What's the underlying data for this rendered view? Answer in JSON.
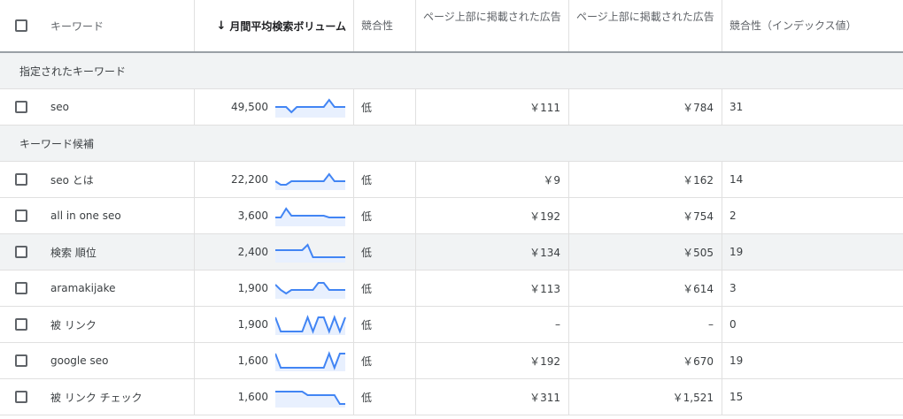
{
  "header": {
    "keyword": "キーワード",
    "volume": "月間平均検索ボリューム",
    "competition": "競合性",
    "bid_low": "ページ上部に掲載された広告",
    "bid_high": "ページ上部に掲載された広告",
    "comp_index": "競合性（インデックス値）",
    "sort_icon": "arrow-down-icon"
  },
  "groups": {
    "specified": "指定されたキーワード",
    "suggestions": "キーワード候補"
  },
  "rows": [
    {
      "keyword": "seo",
      "volume": "49,500",
      "competition": "低",
      "bid_low": "￥111",
      "bid_high": "￥784",
      "index": "31",
      "trend": [
        5,
        5,
        5,
        8,
        5,
        5,
        5,
        5,
        5,
        5,
        1,
        5,
        5,
        5
      ]
    },
    {
      "keyword": "seo とは",
      "volume": "22,200",
      "competition": "低",
      "bid_low": "￥9",
      "bid_high": "￥162",
      "index": "14",
      "trend": [
        6,
        8,
        8,
        6,
        6,
        6,
        6,
        6,
        6,
        6,
        2,
        6,
        6,
        6
      ]
    },
    {
      "keyword": "all in one seo",
      "volume": "3,600",
      "competition": "低",
      "bid_low": "￥192",
      "bid_high": "￥754",
      "index": "2",
      "trend": [
        6,
        6,
        1,
        5,
        5,
        5,
        5,
        5,
        5,
        5,
        6,
        6,
        6,
        6
      ]
    },
    {
      "keyword": "検索 順位",
      "volume": "2,400",
      "competition": "低",
      "bid_low": "￥134",
      "bid_high": "￥505",
      "index": "19",
      "trend": [
        4,
        4,
        4,
        4,
        4,
        4,
        1,
        8,
        8,
        8,
        8,
        8,
        8,
        8
      ]
    },
    {
      "keyword": "aramakijake",
      "volume": "1,900",
      "competition": "低",
      "bid_low": "￥113",
      "bid_high": "￥614",
      "index": "3",
      "trend": [
        3,
        6,
        8,
        6,
        6,
        6,
        6,
        6,
        2,
        2,
        6,
        6,
        6,
        6
      ]
    },
    {
      "keyword": "被 リンク",
      "volume": "1,900",
      "competition": "低",
      "bid_low": "–",
      "bid_high": "–",
      "index": "0",
      "trend": [
        1,
        9,
        9,
        9,
        9,
        9,
        1,
        9,
        1,
        1,
        9,
        1,
        9,
        1
      ]
    },
    {
      "keyword": "google seo",
      "volume": "1,600",
      "competition": "低",
      "bid_low": "￥192",
      "bid_high": "￥670",
      "index": "19",
      "trend": [
        1,
        9,
        9,
        9,
        9,
        9,
        9,
        9,
        9,
        9,
        1,
        9,
        1,
        1
      ]
    },
    {
      "keyword": "被 リンク チェック",
      "volume": "1,600",
      "competition": "低",
      "bid_low": "￥311",
      "bid_high": "￥1,521",
      "index": "15",
      "trend": [
        2,
        2,
        2,
        2,
        2,
        2,
        4,
        4,
        4,
        4,
        4,
        4,
        9,
        9
      ]
    }
  ]
}
